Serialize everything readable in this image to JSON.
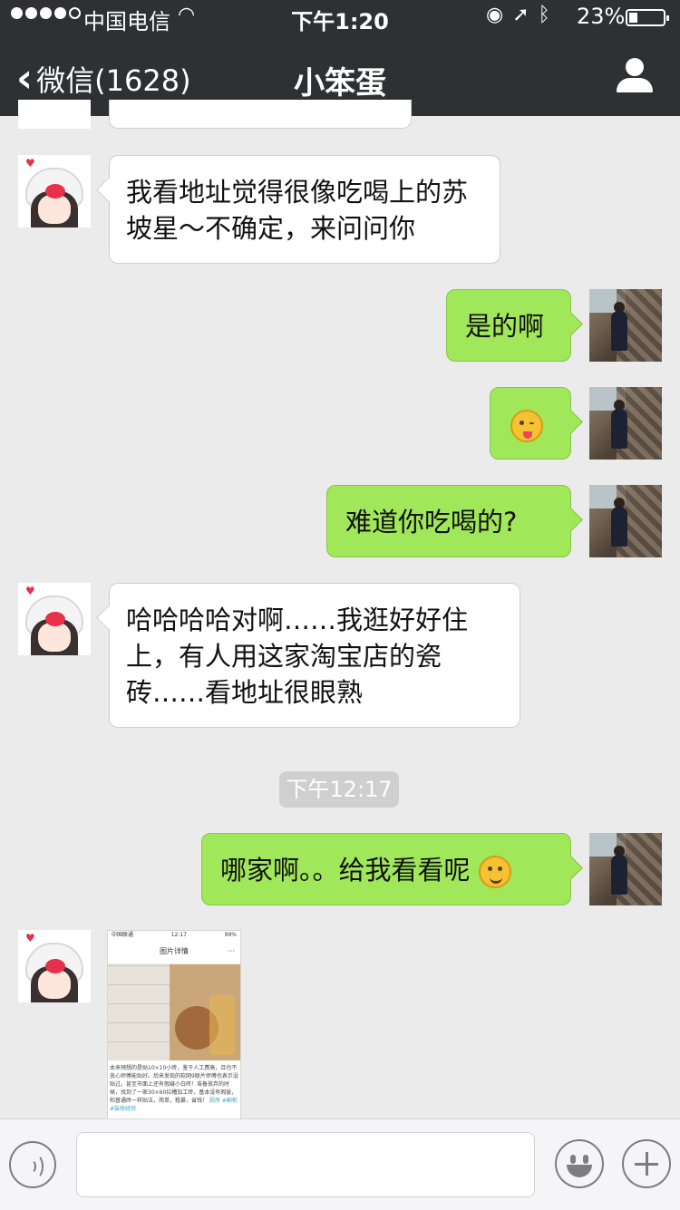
{
  "status_bar": {
    "carrier": "中国电信",
    "time": "下午1:20",
    "battery": "23%",
    "battery_level": 0.23,
    "icons": [
      "lock-rotation-icon",
      "location-icon",
      "bluetooth-icon"
    ]
  },
  "nav": {
    "back_label": "微信(1628)",
    "title": "小笨蛋"
  },
  "messages": [
    {
      "side": "left",
      "text": "我看地址觉得很像吃喝上的苏坡星～不确定，来问问你"
    },
    {
      "side": "right",
      "text": "是的啊"
    },
    {
      "side": "right",
      "emoji": "winking-tongue-emoji"
    },
    {
      "side": "right",
      "text": "难道你吃喝的?"
    },
    {
      "side": "left",
      "text": "哈哈哈哈对啊……我逛好好住上，有人用这家淘宝店的瓷砖……看地址很眼熟"
    },
    {
      "side": "right",
      "text": "哪家啊。。给我看看呢",
      "emoji": "smile-emoji"
    }
  ],
  "timestamp": "下午12:17",
  "shared_image": {
    "status": "中国联通",
    "time": "12:17",
    "battery": "99%",
    "title": "图片详情",
    "more": "···",
    "caption": "本来预想的是贴10×10小砖，鉴于人工费高，且也不放心师傅能贴好。后来发现的软网9联片师傅也表示没贴过。甚至市面上还有假缝小白砖！准备放弃的时候，找到了一家30×60拉槽加工砖，基本没有瑕疵，和普通砖一样贴法，简单，粗暴，省钱！",
    "tags": "厨房 #橱柜 #装修经验"
  },
  "input_bar": {
    "placeholder": ""
  },
  "colors": {
    "nav_bg": "#2f3033",
    "chat_bg": "#ebebeb",
    "sent_bubble": "#a0e75a",
    "received_bubble": "#ffffff"
  }
}
